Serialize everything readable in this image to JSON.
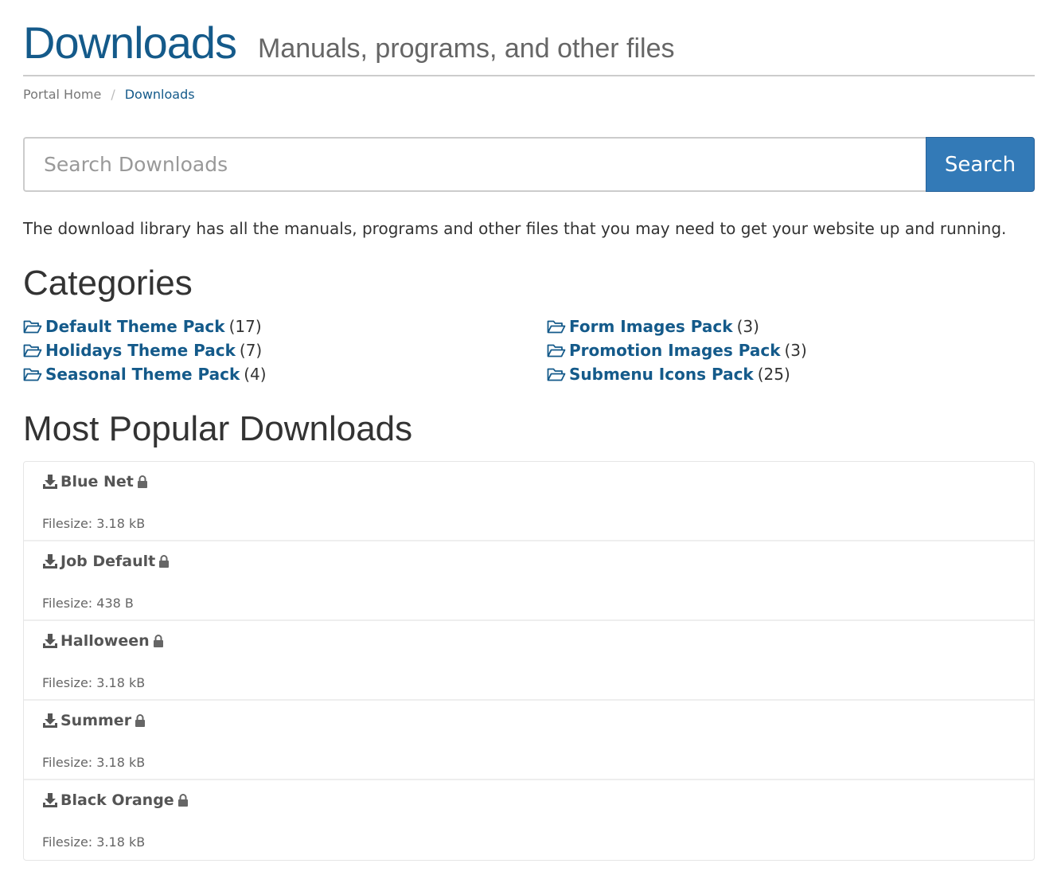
{
  "header": {
    "title": "Downloads",
    "subtitle": "Manuals, programs, and other files"
  },
  "breadcrumb": {
    "home": "Portal Home",
    "separator": "/",
    "current": "Downloads"
  },
  "search": {
    "placeholder": "Search Downloads",
    "value": "",
    "button_label": "Search"
  },
  "intro": "The download library has all the manuals, programs and other files that you may need to get your website up and running.",
  "categories": {
    "heading": "Categories",
    "items": [
      {
        "name": "Default Theme Pack",
        "count": "(17)"
      },
      {
        "name": "Holidays Theme Pack",
        "count": "(7)"
      },
      {
        "name": "Seasonal Theme Pack",
        "count": "(4)"
      },
      {
        "name": "Form Images Pack",
        "count": "(3)"
      },
      {
        "name": "Promotion Images Pack",
        "count": "(3)"
      },
      {
        "name": "Submenu Icons Pack",
        "count": "(25)"
      }
    ]
  },
  "popular": {
    "heading": "Most Popular Downloads",
    "items": [
      {
        "name": "Blue Net",
        "filesize": "Filesize: 3.18 kB"
      },
      {
        "name": "Job Default",
        "filesize": "Filesize: 438 B"
      },
      {
        "name": "Halloween",
        "filesize": "Filesize: 3.18 kB"
      },
      {
        "name": "Summer",
        "filesize": "Filesize: 3.18 kB"
      },
      {
        "name": "Black Orange",
        "filesize": "Filesize: 3.18 kB"
      }
    ]
  },
  "icons": {
    "category": "folder-open-icon",
    "download": "download-icon",
    "locked": "lock-icon"
  },
  "colors": {
    "link": "#145a8a",
    "primary_button": "#337ab7",
    "text": "#333333",
    "muted": "#777777"
  }
}
